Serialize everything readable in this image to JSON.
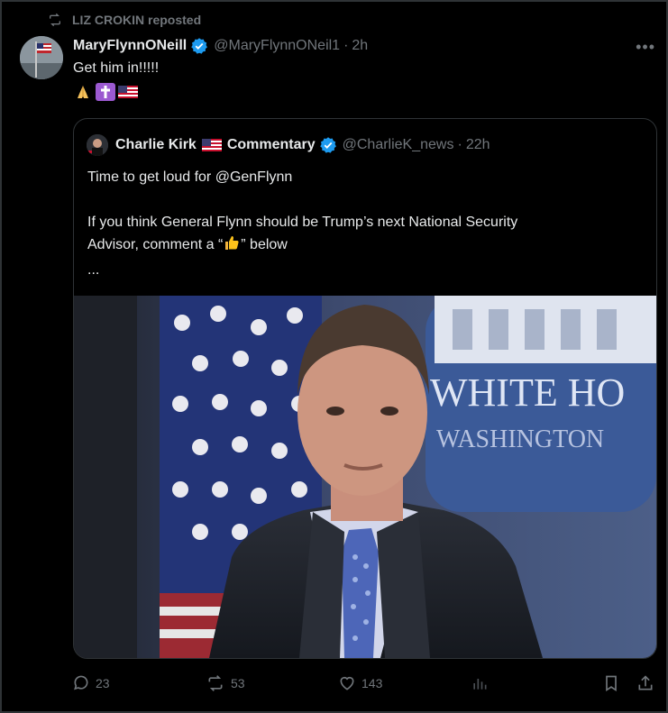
{
  "repost": {
    "label": "LIZ CROKIN reposted"
  },
  "post": {
    "display_name": "MaryFlynnONeill",
    "handle": "@MaryFlynnONeil1",
    "separator": "·",
    "time": "2h",
    "text": "Get him in!!!!!",
    "emojis": [
      "praying-hands-emoji",
      "latin-cross-emoji",
      "us-flag-emoji"
    ]
  },
  "quote": {
    "name_part1": "Charlie Kirk",
    "name_part2": "Commentary",
    "handle": "@CharlieK_news",
    "separator": "·",
    "time": "22h",
    "line1": "Time to get loud for @GenFlynn",
    "line2a": "If you think General Flynn should be Trump’s next National Security",
    "line2b_pre": "Advisor, comment a “",
    "line2b_post": "” below",
    "ellipsis": "...",
    "image": {
      "sign_line1": "WHITE HO",
      "sign_line2": "WASHINGTON"
    }
  },
  "actions": {
    "replies": "23",
    "reposts": "53",
    "likes": "143"
  },
  "colors": {
    "background": "#000000",
    "text": "#e7e9ea",
    "muted": "#71767b",
    "verified": "#1d9bf0",
    "border": "#2f3336"
  }
}
